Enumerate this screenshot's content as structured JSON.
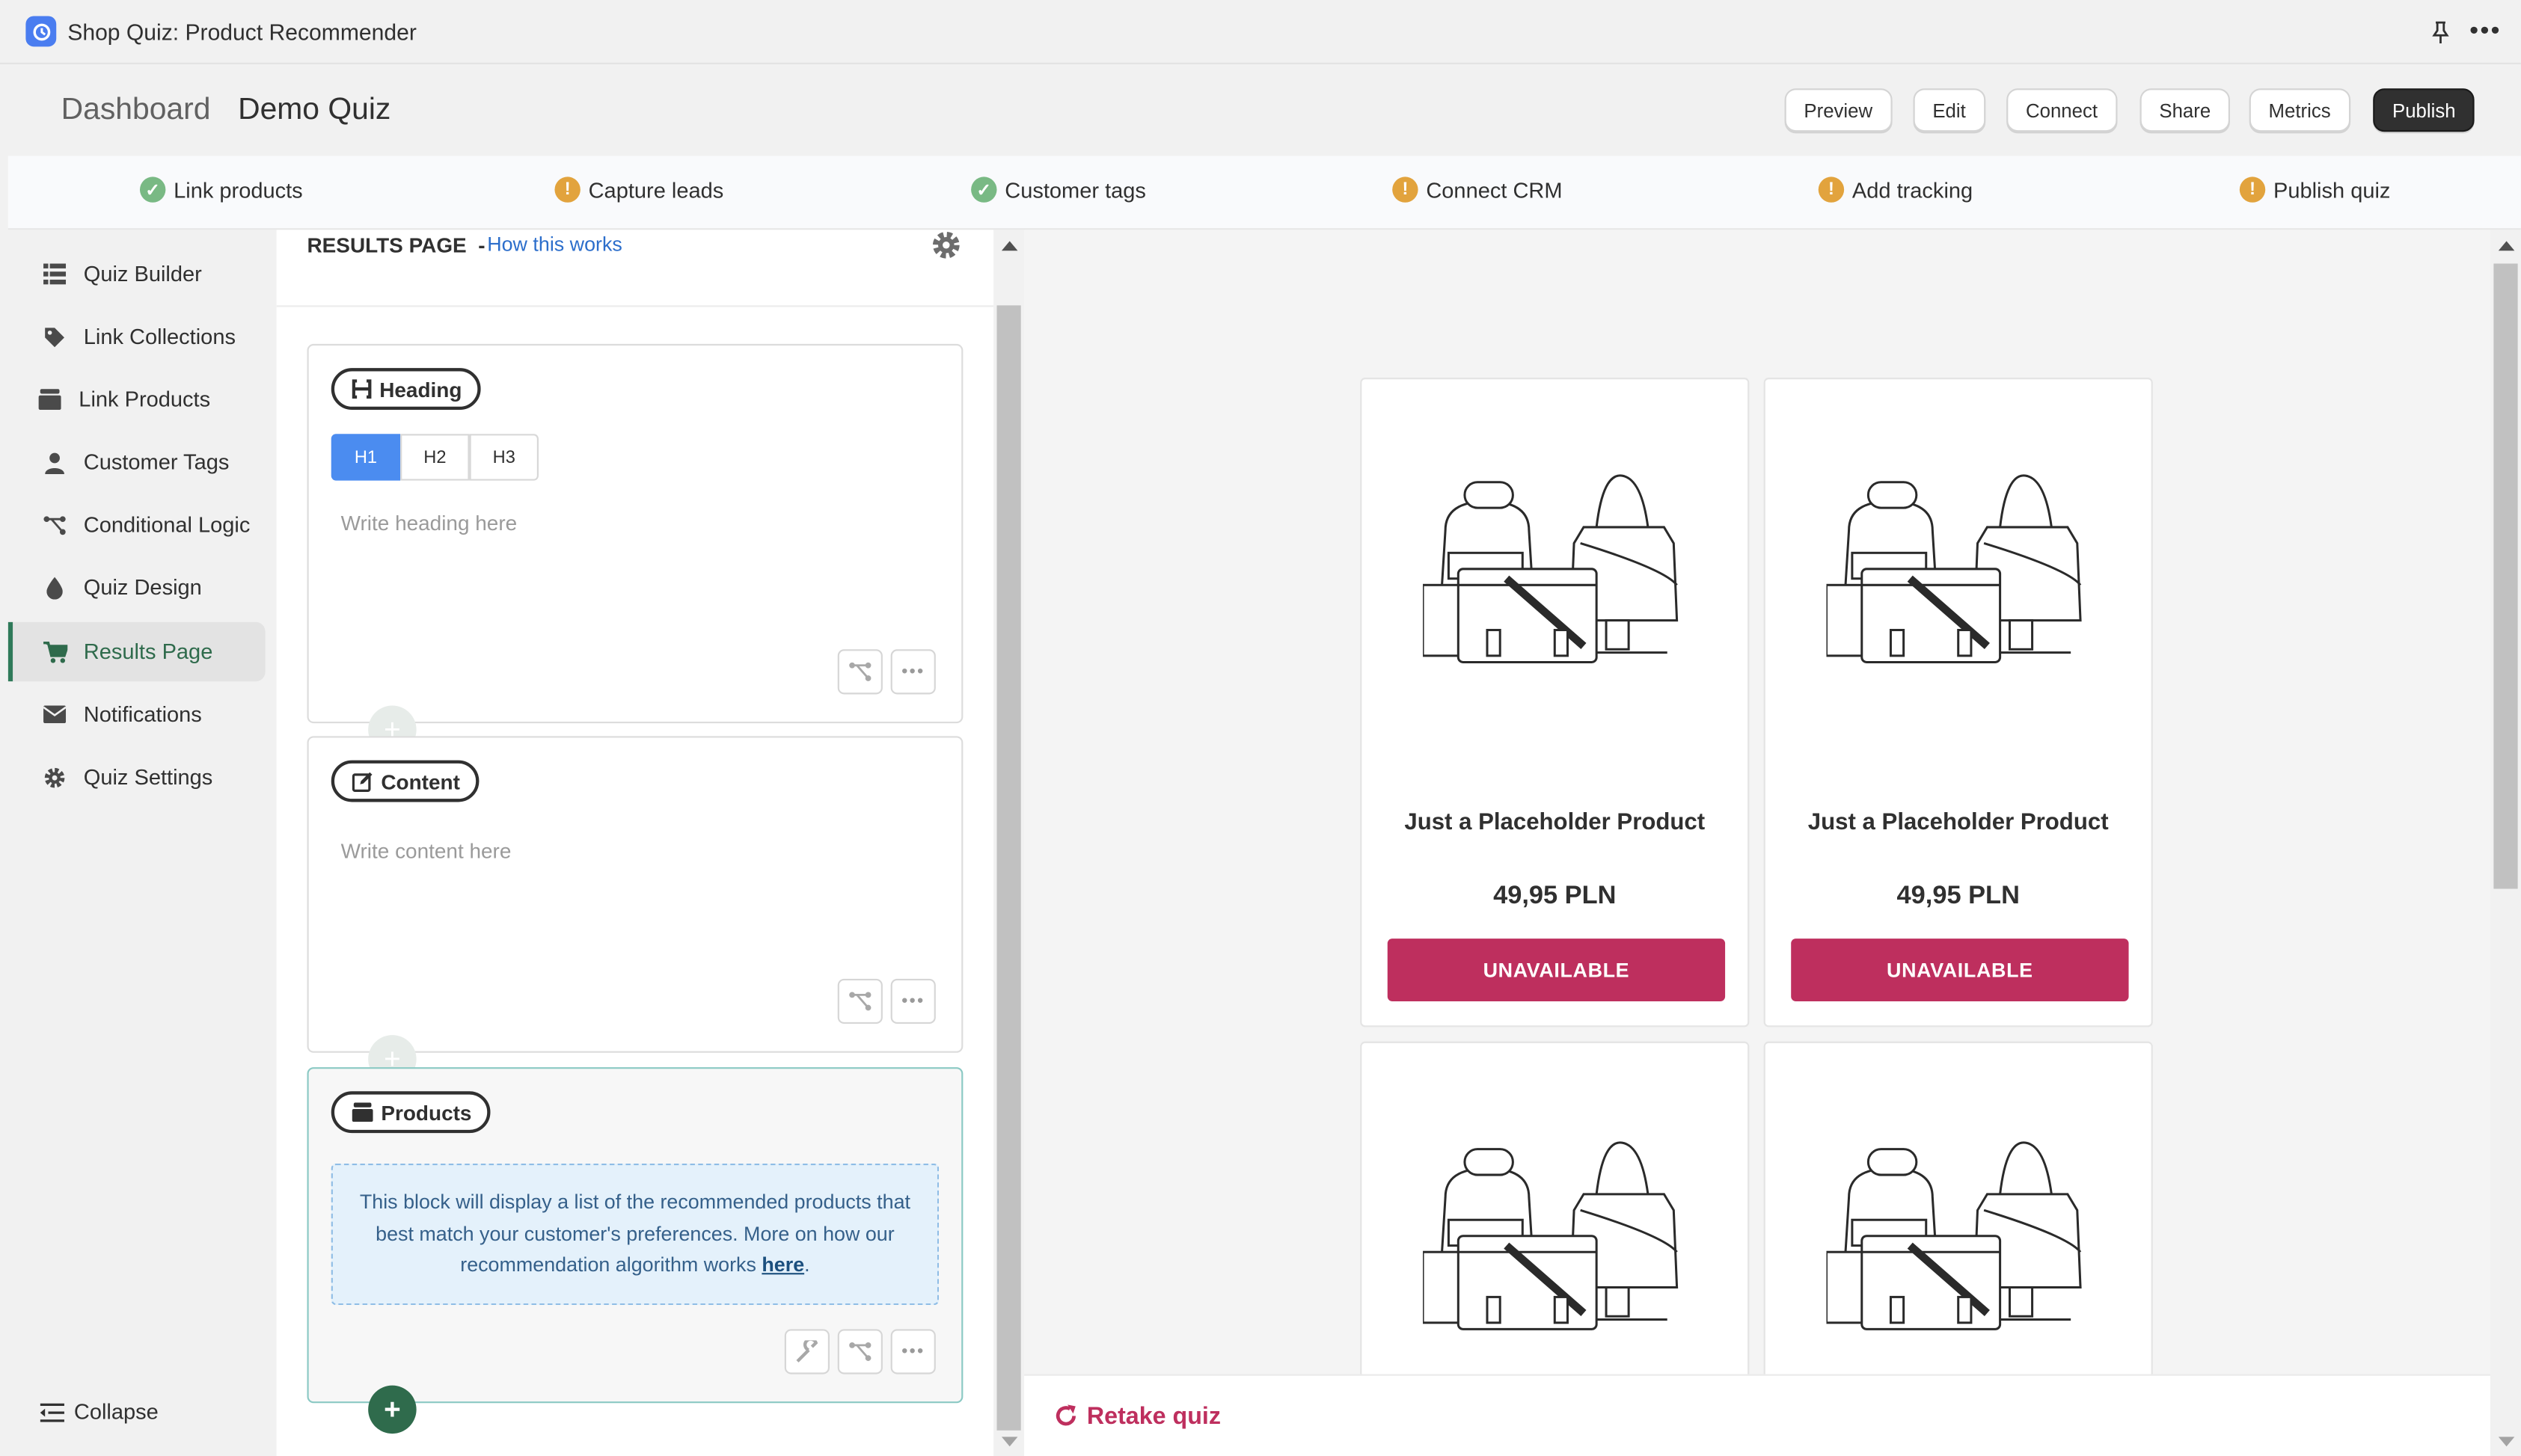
{
  "window": {
    "title": "Shop Quiz: Product Recommender"
  },
  "breadcrumb": {
    "parent": "Dashboard",
    "current": "Demo Quiz"
  },
  "header_buttons": {
    "preview": "Preview",
    "edit": "Edit",
    "connect": "Connect",
    "share": "Share",
    "metrics": "Metrics",
    "publish": "Publish"
  },
  "checklist": [
    {
      "label": "Link products",
      "status": "done"
    },
    {
      "label": "Capture leads",
      "status": "warning"
    },
    {
      "label": "Customer tags",
      "status": "done"
    },
    {
      "label": "Connect CRM",
      "status": "warning"
    },
    {
      "label": "Add tracking",
      "status": "warning"
    },
    {
      "label": "Publish quiz",
      "status": "warning"
    }
  ],
  "sidebar": {
    "items": [
      {
        "label": "Quiz Builder",
        "icon": "list-icon"
      },
      {
        "label": "Link Collections",
        "icon": "tag-icon"
      },
      {
        "label": "Link Products",
        "icon": "box-icon"
      },
      {
        "label": "Customer Tags",
        "icon": "person-icon"
      },
      {
        "label": "Conditional Logic",
        "icon": "branch-icon"
      },
      {
        "label": "Quiz Design",
        "icon": "droplet-icon"
      },
      {
        "label": "Results Page",
        "icon": "cart-icon",
        "active": true
      },
      {
        "label": "Notifications",
        "icon": "envelope-icon"
      },
      {
        "label": "Quiz Settings",
        "icon": "gear-icon"
      }
    ],
    "collapse_label": "Collapse"
  },
  "editor": {
    "section_title": "RESULTS PAGE",
    "separator": "-",
    "help_link": "How this works",
    "heading_block": {
      "label": "Heading",
      "levels": [
        "H1",
        "H2",
        "H3"
      ],
      "selected_level": "H1",
      "placeholder": "Write heading here"
    },
    "content_block": {
      "label": "Content",
      "placeholder": "Write content here"
    },
    "products_block": {
      "label": "Products",
      "info_text": "This block will display a list of the recommended products that best match your customer's preferences. More on how our recommendation algorithm works ",
      "info_link": "here",
      "info_suffix": "."
    }
  },
  "preview": {
    "products": [
      {
        "name": "Just a Placeholder Product",
        "price": "49,95 PLN",
        "button": "UNAVAILABLE"
      },
      {
        "name": "Just a Placeholder Product",
        "price": "49,95 PLN",
        "button": "UNAVAILABLE"
      },
      {
        "name": "",
        "price": "",
        "button": ""
      },
      {
        "name": "",
        "price": "",
        "button": ""
      }
    ],
    "retake_label": "Retake quiz"
  },
  "colors": {
    "accent_primary": "#303030",
    "success": "#79b984",
    "warning": "#e2a33d",
    "product_button": "#be2f5e",
    "active_nav_indicator": "#2f7a5a",
    "link": "#2c6ecb"
  }
}
